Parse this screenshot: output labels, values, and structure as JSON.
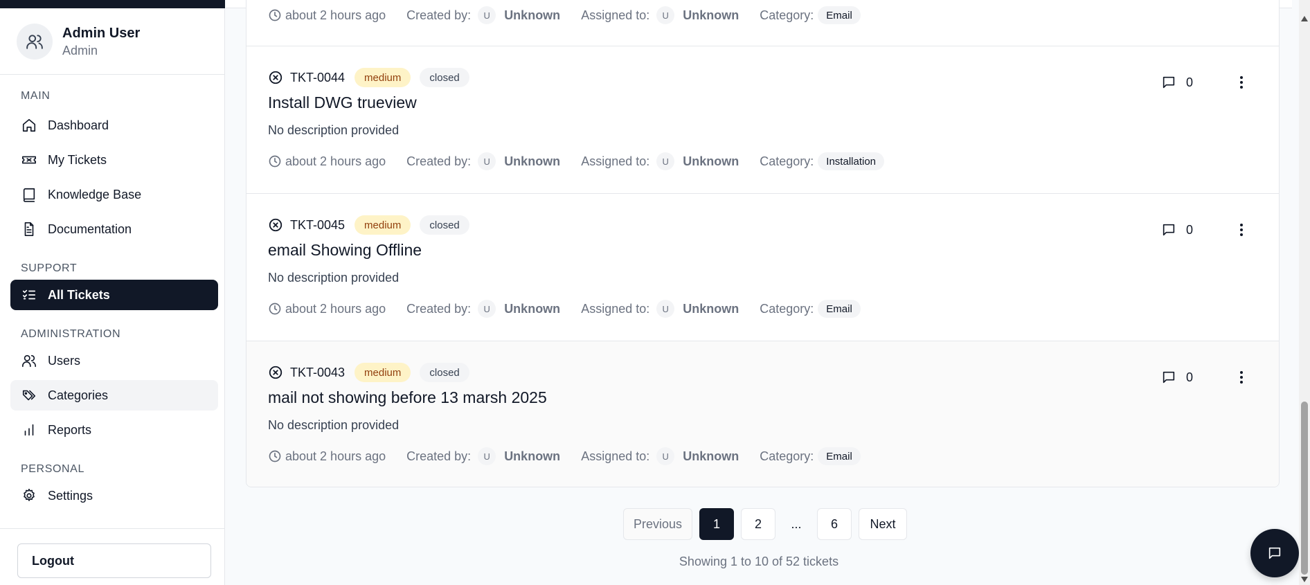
{
  "user": {
    "name": "Admin User",
    "role": "Admin"
  },
  "sidebar": {
    "sections": {
      "main": "MAIN",
      "support": "SUPPORT",
      "administration": "ADMINISTRATION",
      "personal": "PERSONAL"
    },
    "items": {
      "dashboard": "Dashboard",
      "my_tickets": "My Tickets",
      "knowledge_base": "Knowledge Base",
      "documentation": "Documentation",
      "all_tickets": "All Tickets",
      "users": "Users",
      "categories": "Categories",
      "reports": "Reports",
      "settings": "Settings"
    },
    "logout": "Logout"
  },
  "meta_labels": {
    "created_by": "Created by:",
    "assigned_to": "Assigned to:",
    "category": "Category:"
  },
  "partial_ticket": {
    "time": "about 2 hours ago",
    "created_initial": "U",
    "created_name": "Unknown",
    "assigned_initial": "U",
    "assigned_name": "Unknown",
    "category": "Email"
  },
  "tickets": [
    {
      "id": "TKT-0044",
      "priority": "medium",
      "status": "closed",
      "title": "Install DWG trueview",
      "description": "No description provided",
      "time": "about 2 hours ago",
      "created_initial": "U",
      "created_name": "Unknown",
      "assigned_initial": "U",
      "assigned_name": "Unknown",
      "category": "Installation",
      "comments": "0"
    },
    {
      "id": "TKT-0045",
      "priority": "medium",
      "status": "closed",
      "title": "email Showing Offline",
      "description": "No description provided",
      "time": "about 2 hours ago",
      "created_initial": "U",
      "created_name": "Unknown",
      "assigned_initial": "U",
      "assigned_name": "Unknown",
      "category": "Email",
      "comments": "0"
    },
    {
      "id": "TKT-0043",
      "priority": "medium",
      "status": "closed",
      "title": "mail not showing before 13 marsh 2025",
      "description": "No description provided",
      "time": "about 2 hours ago",
      "created_initial": "U",
      "created_name": "Unknown",
      "assigned_initial": "U",
      "assigned_name": "Unknown",
      "category": "Email",
      "comments": "0"
    }
  ],
  "pagination": {
    "previous": "Previous",
    "pages": [
      "1",
      "2",
      "6"
    ],
    "ellipsis": "...",
    "next": "Next",
    "current": "1",
    "summary": "Showing 1 to 10 of 52 tickets"
  },
  "colors": {
    "primary": "#111827",
    "priority_medium_bg": "#fef3c7",
    "priority_medium_text": "#92400e",
    "muted_text": "#6b7280"
  }
}
